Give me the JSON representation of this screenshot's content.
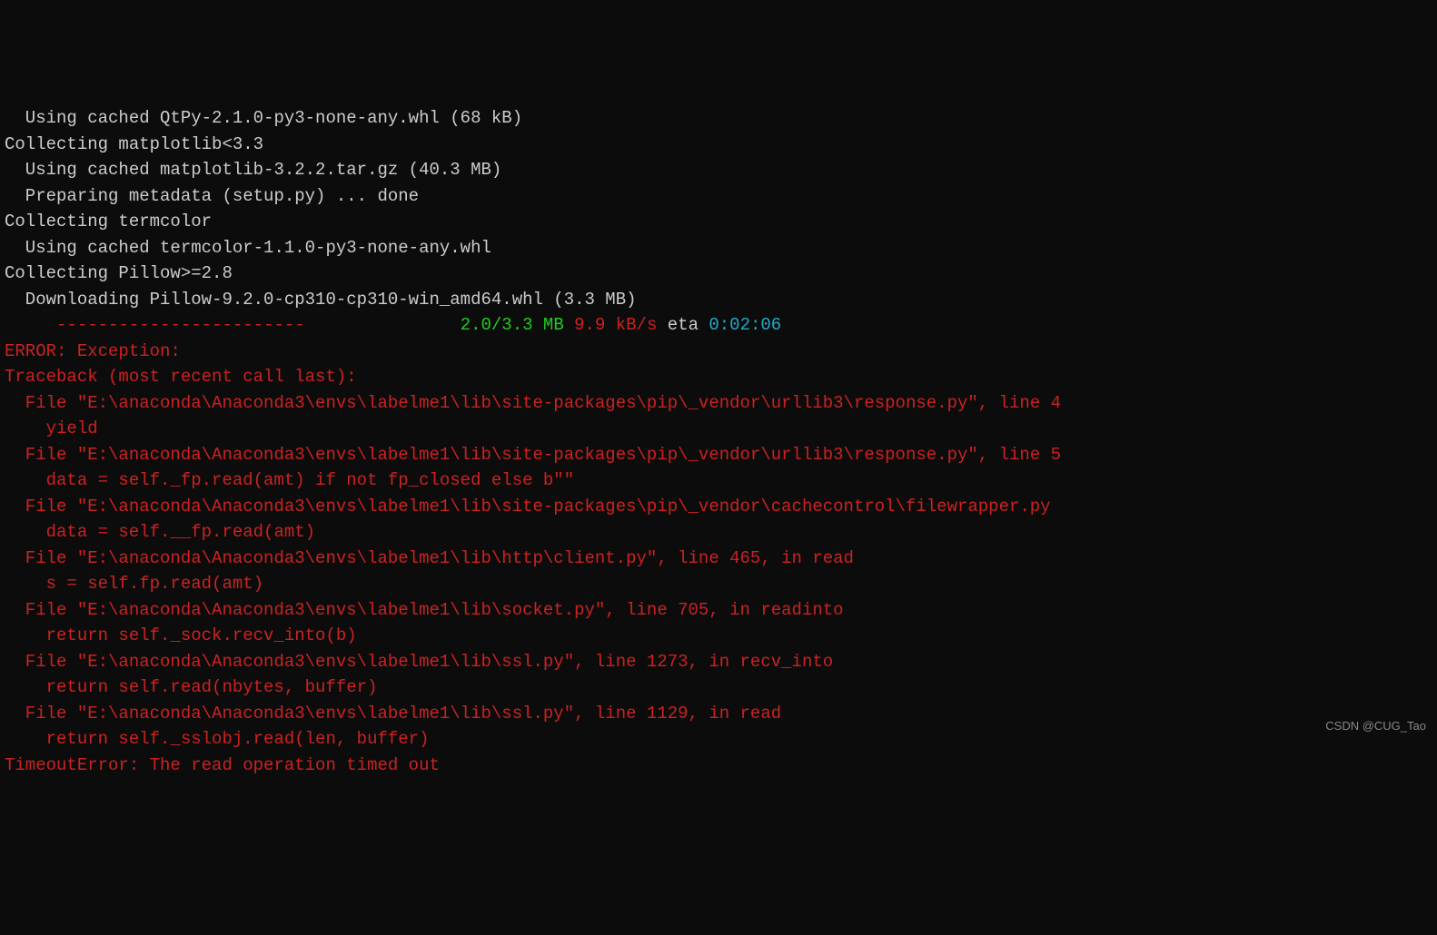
{
  "terminal": {
    "lines": [
      {
        "segments": [
          {
            "text": "  Using cached QtPy-2.1.0-py3-none-any.whl (68 kB)",
            "class": "white"
          }
        ]
      },
      {
        "segments": [
          {
            "text": "Collecting matplotlib<3.3",
            "class": "white"
          }
        ]
      },
      {
        "segments": [
          {
            "text": "  Using cached matplotlib-3.2.2.tar.gz (40.3 MB)",
            "class": "white"
          }
        ]
      },
      {
        "segments": [
          {
            "text": "  Preparing metadata (setup.py) ... done",
            "class": "white"
          }
        ]
      },
      {
        "segments": [
          {
            "text": "Collecting termcolor",
            "class": "white"
          }
        ]
      },
      {
        "segments": [
          {
            "text": "  Using cached termcolor-1.1.0-py3-none-any.whl",
            "class": "white"
          }
        ]
      },
      {
        "segments": [
          {
            "text": "Collecting Pillow>=2.8",
            "class": "white"
          }
        ]
      },
      {
        "segments": [
          {
            "text": "  Downloading Pillow-9.2.0-cp310-cp310-win_amd64.whl (3.3 MB)",
            "class": "white"
          }
        ]
      },
      {
        "segments": [
          {
            "text": "     ",
            "class": "white"
          },
          {
            "text": "------------------------",
            "class": "red"
          },
          {
            "text": "               ",
            "class": "white"
          },
          {
            "text": "2.0/3.3 MB",
            "class": "green"
          },
          {
            "text": " ",
            "class": "white"
          },
          {
            "text": "9.9 kB/s",
            "class": "red"
          },
          {
            "text": " eta ",
            "class": "white"
          },
          {
            "text": "0:02:06",
            "class": "cyan"
          }
        ]
      },
      {
        "segments": [
          {
            "text": "ERROR: Exception:",
            "class": "red"
          }
        ]
      },
      {
        "segments": [
          {
            "text": "Traceback (most recent call last):",
            "class": "red"
          }
        ]
      },
      {
        "segments": [
          {
            "text": "  File \"E:\\anaconda\\Anaconda3\\envs\\labelme1\\lib\\site-packages\\pip\\_vendor\\urllib3\\response.py\", line 4",
            "class": "red"
          }
        ]
      },
      {
        "segments": [
          {
            "text": "    yield",
            "class": "red"
          }
        ]
      },
      {
        "segments": [
          {
            "text": "  File \"E:\\anaconda\\Anaconda3\\envs\\labelme1\\lib\\site-packages\\pip\\_vendor\\urllib3\\response.py\", line 5",
            "class": "red"
          }
        ]
      },
      {
        "segments": [
          {
            "text": "    data = self._fp.read(amt) if not fp_closed else b\"\"",
            "class": "red"
          }
        ]
      },
      {
        "segments": [
          {
            "text": "  File \"E:\\anaconda\\Anaconda3\\envs\\labelme1\\lib\\site-packages\\pip\\_vendor\\cachecontrol\\filewrapper.py",
            "class": "red"
          }
        ]
      },
      {
        "segments": [
          {
            "text": "    data = self.__fp.read(amt)",
            "class": "red"
          }
        ]
      },
      {
        "segments": [
          {
            "text": "  File \"E:\\anaconda\\Anaconda3\\envs\\labelme1\\lib\\http\\client.py\", line 465, in read",
            "class": "red"
          }
        ]
      },
      {
        "segments": [
          {
            "text": "    s = self.fp.read(amt)",
            "class": "red"
          }
        ]
      },
      {
        "segments": [
          {
            "text": "  File \"E:\\anaconda\\Anaconda3\\envs\\labelme1\\lib\\socket.py\", line 705, in readinto",
            "class": "red"
          }
        ]
      },
      {
        "segments": [
          {
            "text": "    return self._sock.recv_into(b)",
            "class": "red"
          }
        ]
      },
      {
        "segments": [
          {
            "text": "  File \"E:\\anaconda\\Anaconda3\\envs\\labelme1\\lib\\ssl.py\", line 1273, in recv_into",
            "class": "red"
          }
        ]
      },
      {
        "segments": [
          {
            "text": "    return self.read(nbytes, buffer)",
            "class": "red"
          }
        ]
      },
      {
        "segments": [
          {
            "text": "  File \"E:\\anaconda\\Anaconda3\\envs\\labelme1\\lib\\ssl.py\", line 1129, in read",
            "class": "red"
          }
        ]
      },
      {
        "segments": [
          {
            "text": "    return self._sslobj.read(len, buffer)",
            "class": "red"
          }
        ]
      },
      {
        "segments": [
          {
            "text": "TimeoutError: The read operation timed out",
            "class": "red"
          }
        ]
      }
    ]
  },
  "watermark": "CSDN @CUG_Tao"
}
